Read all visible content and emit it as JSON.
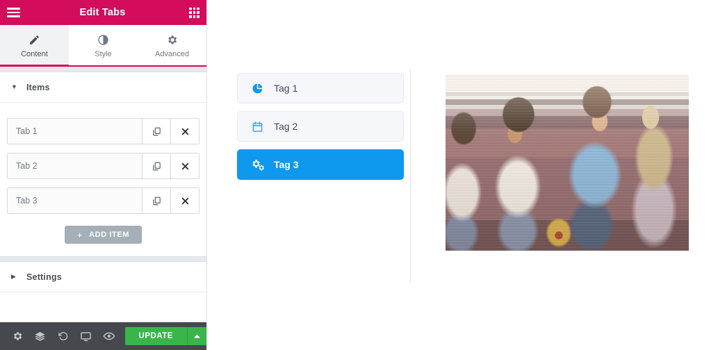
{
  "panel": {
    "header": {
      "title": "Edit Tabs",
      "menu_icon": "hamburger-icon",
      "apps_icon": "grid-icon"
    },
    "tabs": [
      {
        "label": "Content",
        "icon": "pencil-icon",
        "active": true
      },
      {
        "label": "Style",
        "icon": "contrast-icon",
        "active": false
      },
      {
        "label": "Advanced",
        "icon": "gear-icon",
        "active": false
      }
    ],
    "sections": {
      "items": {
        "label": "Items",
        "expanded": true,
        "caret": "caret-down-icon",
        "rows": [
          {
            "value": "Tab 1",
            "duplicate_icon": "duplicate-icon",
            "remove_icon": "close-icon"
          },
          {
            "value": "Tab 2",
            "duplicate_icon": "duplicate-icon",
            "remove_icon": "close-icon"
          },
          {
            "value": "Tab 3",
            "duplicate_icon": "duplicate-icon",
            "remove_icon": "close-icon"
          }
        ],
        "add_item": {
          "label": "ADD ITEM",
          "plus": "+"
        }
      },
      "settings": {
        "label": "Settings",
        "expanded": false,
        "caret": "caret-right-icon"
      }
    },
    "footer": {
      "icons": [
        "gear-icon",
        "layers-icon",
        "history-icon",
        "responsive-monitor-icon",
        "eye-preview-icon"
      ],
      "update_label": "UPDATE",
      "update_caret": "caret-up-icon"
    },
    "collapse_handle": "chevron-left-icon"
  },
  "canvas": {
    "widget_tabs": [
      {
        "label": "Tag 1",
        "icon": "pie-chart-icon",
        "active": false
      },
      {
        "label": "Tag 2",
        "icon": "calendar-icon",
        "active": false
      },
      {
        "label": "Tag 3",
        "icon": "cogs-icon",
        "active": true
      }
    ],
    "media": {
      "alt": "four-young-friends-looking-at-smartphones"
    }
  },
  "colors": {
    "brand_pink": "#d30c5c",
    "accent_blue": "#0e98ee",
    "update_green": "#39b54a",
    "toolbar_dark": "#45494e",
    "add_item_grey": "#a4afb7",
    "tab_inactive_bg": "#f6f7fa",
    "tab_text": "#3b4a5e"
  }
}
